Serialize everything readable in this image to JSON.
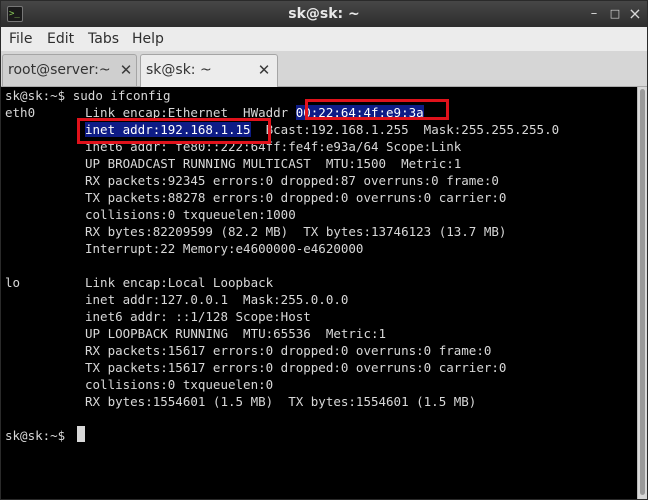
{
  "window": {
    "title": "sk@sk: ~",
    "controls": {
      "minimize": "–",
      "maximize": "□",
      "close": "×"
    }
  },
  "menu": [
    "File",
    "Edit",
    "Tabs",
    "Help"
  ],
  "tabs": [
    {
      "label": "root@server:~",
      "active": false
    },
    {
      "label": "sk@sk: ~",
      "active": true
    }
  ],
  "terminal": {
    "prompt": "sk@sk:~$",
    "command": "sudo ifconfig",
    "eth0": {
      "iface": "eth0",
      "encap": "Link encap:Ethernet  HWaddr ",
      "mac": "00:22:64:4f:e9:3a",
      "inet_addr": "inet addr:192.168.1.15",
      "inet_rest": "  Bcast:192.168.1.255  Mask:255.255.255.0",
      "inet6": "inet6 addr: fe80::222:64ff:fe4f:e93a/64 Scope:Link",
      "flags": "UP BROADCAST RUNNING MULTICAST  MTU:1500  Metric:1",
      "rx_packets": "RX packets:92345 errors:0 dropped:87 overruns:0 frame:0",
      "tx_packets": "TX packets:88278 errors:0 dropped:0 overruns:0 carrier:0",
      "collisions": "collisions:0 txqueuelen:1000",
      "bytes": "RX bytes:82209599 (82.2 MB)  TX bytes:13746123 (13.7 MB)",
      "interrupt": "Interrupt:22 Memory:e4600000-e4620000"
    },
    "lo": {
      "iface": "lo",
      "encap": "Link encap:Local Loopback",
      "inet": "inet addr:127.0.0.1  Mask:255.0.0.0",
      "inet6": "inet6 addr: ::1/128 Scope:Host",
      "flags": "UP LOOPBACK RUNNING  MTU:65536  Metric:1",
      "rx_packets": "RX packets:15617 errors:0 dropped:0 overruns:0 frame:0",
      "tx_packets": "TX packets:15617 errors:0 dropped:0 overruns:0 carrier:0",
      "collisions": "collisions:0 txqueuelen:0",
      "bytes": "RX bytes:1554601 (1.5 MB)  TX bytes:1554601 (1.5 MB)"
    },
    "final_prompt": "sk@sk:~$"
  },
  "colors": {
    "highlight_border": "#e0121b",
    "selection_bg": "#0e1c86",
    "terminal_bg": "#000000",
    "terminal_fg": "#d8d8d8"
  }
}
